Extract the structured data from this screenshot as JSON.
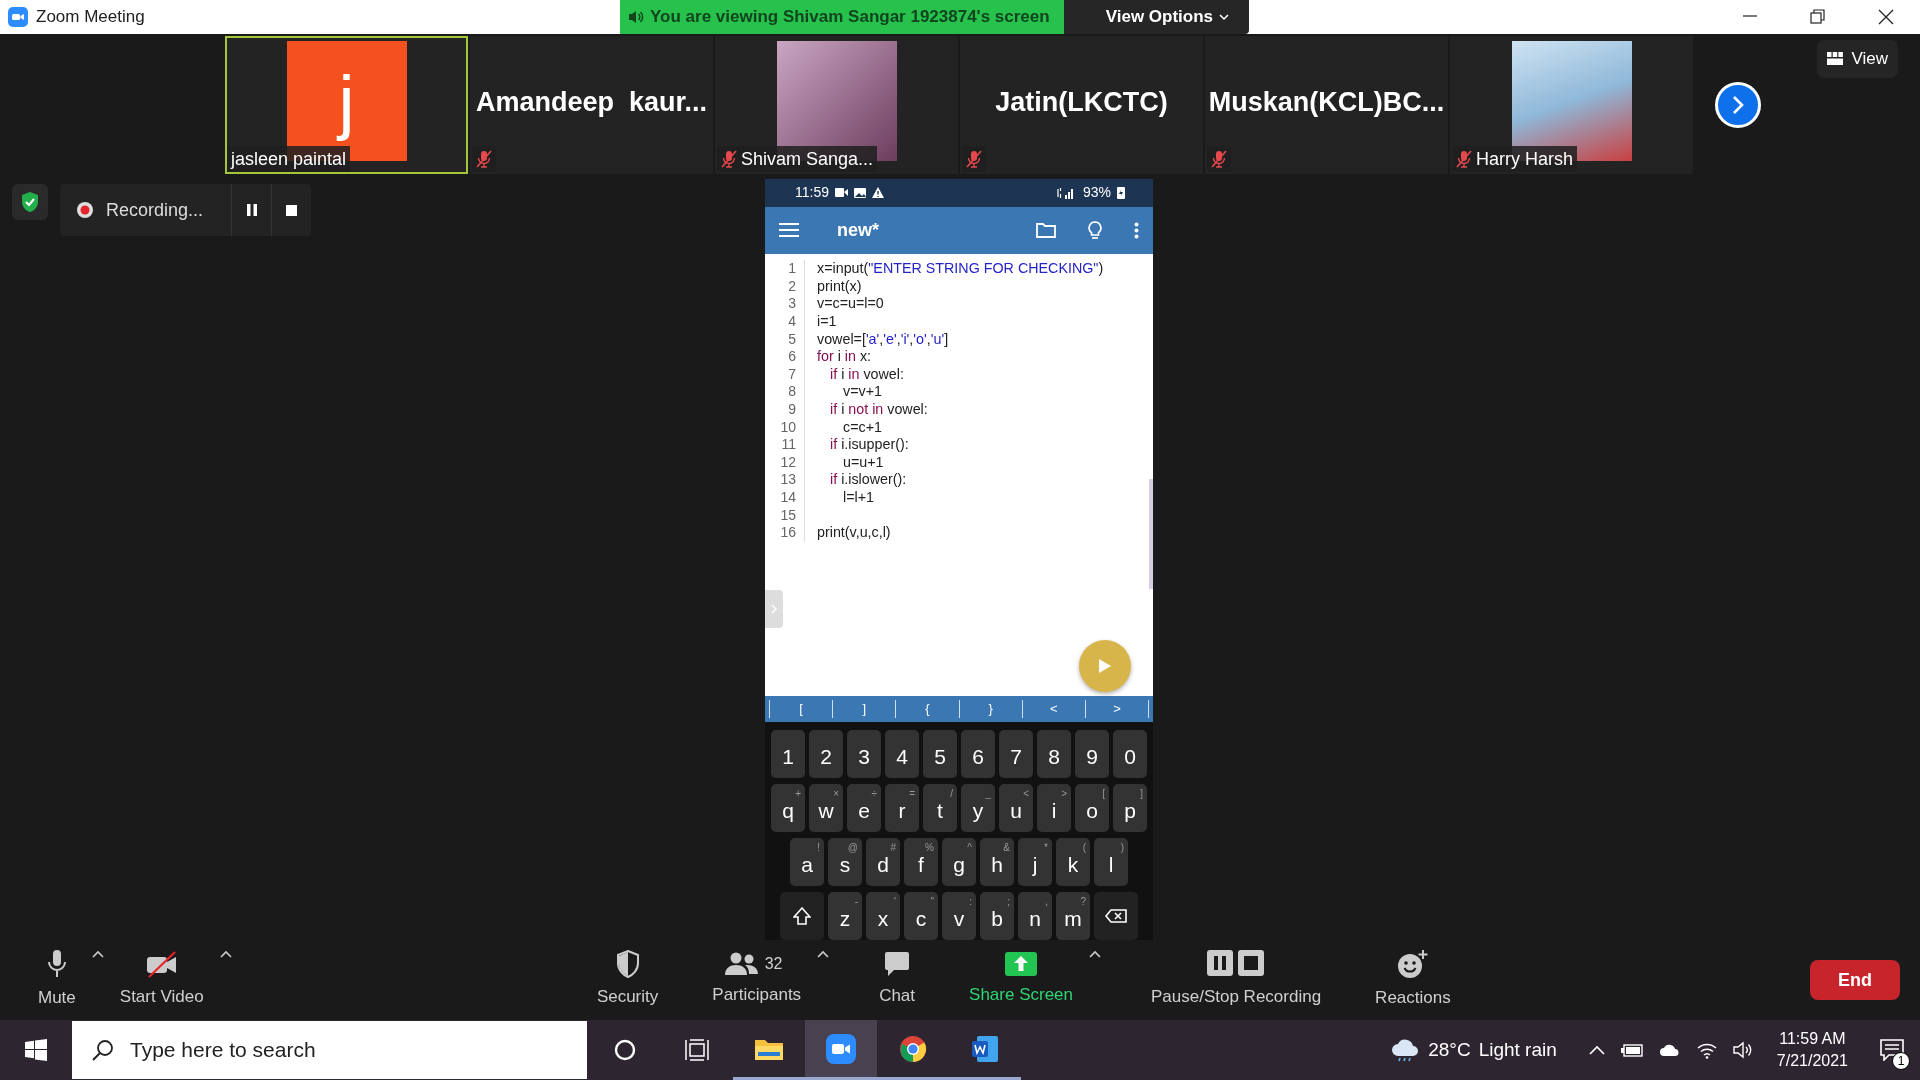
{
  "window": {
    "title": "Zoom Meeting"
  },
  "share_banner": {
    "text": "You are viewing Shivam Sangar 1923874's screen",
    "options": "View Options"
  },
  "participants": [
    {
      "kind": "avatar",
      "letter": "j",
      "color": "#f4511e",
      "label": "jasleen paintal",
      "muted": false,
      "speaking": true
    },
    {
      "kind": "name",
      "name": "Amandeep  kaur...",
      "muted": true,
      "speaking": false
    },
    {
      "kind": "photo",
      "label": "Shivam Sanga...",
      "muted": true,
      "speaking": false
    },
    {
      "kind": "name",
      "name": "Jatin(LKCTC)",
      "muted": true,
      "speaking": false
    },
    {
      "kind": "name",
      "name": "Muskan(KCL)BC...",
      "muted": true,
      "speaking": false
    },
    {
      "kind": "photo",
      "label": "Harry Harsh",
      "muted": true,
      "speaking": false
    }
  ],
  "view_button": "View",
  "recording": {
    "label": "Recording..."
  },
  "phone": {
    "status": {
      "time": "11:59",
      "battery": "93%"
    },
    "app": {
      "title": "new*"
    },
    "code": [
      {
        "number": "1",
        "tokens": [
          {
            "kind": "plain",
            "text": "x=input("
          },
          {
            "kind": "string",
            "text": "\"ENTER STRING FOR CHECKING\""
          },
          {
            "kind": "plain",
            "text": ")"
          }
        ]
      },
      {
        "number": "2",
        "tokens": [
          {
            "kind": "plain",
            "text": "print(x)"
          }
        ]
      },
      {
        "number": "3",
        "tokens": [
          {
            "kind": "plain",
            "text": "v=c=u=l=0"
          }
        ]
      },
      {
        "number": "4",
        "tokens": [
          {
            "kind": "plain",
            "text": "i=1"
          }
        ]
      },
      {
        "number": "5",
        "tokens": [
          {
            "kind": "plain",
            "text": "vowel=["
          },
          {
            "kind": "string",
            "text": "'a'"
          },
          {
            "kind": "plain",
            "text": ","
          },
          {
            "kind": "string",
            "text": "'e'"
          },
          {
            "kind": "plain",
            "text": ","
          },
          {
            "kind": "string",
            "text": "'i'"
          },
          {
            "kind": "plain",
            "text": ","
          },
          {
            "kind": "string",
            "text": "'o'"
          },
          {
            "kind": "plain",
            "text": ","
          },
          {
            "kind": "string",
            "text": "'u'"
          },
          {
            "kind": "plain",
            "text": "]"
          }
        ]
      },
      {
        "number": "6",
        "tokens": [
          {
            "kind": "keyword",
            "text": "for"
          },
          {
            "kind": "plain",
            "text": " i "
          },
          {
            "kind": "keyword",
            "text": "in"
          },
          {
            "kind": "plain",
            "text": " x:"
          }
        ],
        "children": [
          {
            "number": "7",
            "tokens": [
              {
                "kind": "keyword",
                "text": "if"
              },
              {
                "kind": "plain",
                "text": " i "
              },
              {
                "kind": "keyword",
                "text": "in"
              },
              {
                "kind": "plain",
                "text": " vowel:"
              }
            ],
            "children": [
              {
                "number": "8",
                "tokens": [
                  {
                    "kind": "plain",
                    "text": "v=v+1"
                  }
                ]
              }
            ]
          },
          {
            "number": "9",
            "tokens": [
              {
                "kind": "keyword",
                "text": "if"
              },
              {
                "kind": "plain",
                "text": " i "
              },
              {
                "kind": "keyword",
                "text": "not in"
              },
              {
                "kind": "plain",
                "text": " vowel:"
              }
            ],
            "children": [
              {
                "number": "10",
                "tokens": [
                  {
                    "kind": "plain",
                    "text": "c=c+1"
                  }
                ]
              }
            ]
          },
          {
            "number": "11",
            "tokens": [
              {
                "kind": "keyword",
                "text": "if"
              },
              {
                "kind": "plain",
                "text": " i.isupper():"
              }
            ],
            "children": [
              {
                "number": "12",
                "tokens": [
                  {
                    "kind": "plain",
                    "text": "u=u+1"
                  }
                ]
              }
            ]
          },
          {
            "number": "13",
            "tokens": [
              {
                "kind": "keyword",
                "text": "if"
              },
              {
                "kind": "plain",
                "text": " i.islower():"
              }
            ],
            "children": [
              {
                "number": "14",
                "tokens": [
                  {
                    "kind": "plain",
                    "text": "l=l+1"
                  }
                ]
              }
            ]
          }
        ]
      },
      {
        "number": "15"
      },
      {
        "number": "16",
        "tokens": [
          {
            "kind": "plain",
            "text": "print(v,u,c,l)"
          }
        ]
      }
    ],
    "symbols": [
      "[",
      "]",
      "{",
      "}",
      "<",
      ">"
    ],
    "keyboard": [
      [
        {
          "kind": "key",
          "label": "1"
        },
        {
          "kind": "key",
          "label": "2"
        },
        {
          "kind": "key",
          "label": "3"
        },
        {
          "kind": "key",
          "label": "4"
        },
        {
          "kind": "key",
          "label": "5"
        },
        {
          "kind": "key",
          "label": "6"
        },
        {
          "kind": "key",
          "label": "7"
        },
        {
          "kind": "key",
          "label": "8"
        },
        {
          "kind": "key",
          "label": "9"
        },
        {
          "kind": "key",
          "label": "0"
        }
      ],
      [
        {
          "kind": "key",
          "label": "q",
          "hint": "+"
        },
        {
          "kind": "key",
          "label": "w",
          "hint": "×"
        },
        {
          "kind": "key",
          "label": "e",
          "hint": "÷"
        },
        {
          "kind": "key",
          "label": "r",
          "hint": "="
        },
        {
          "kind": "key",
          "label": "t",
          "hint": "/"
        },
        {
          "kind": "key",
          "label": "y",
          "hint": "_"
        },
        {
          "kind": "key",
          "label": "u",
          "hint": "<"
        },
        {
          "kind": "key",
          "label": "i",
          "hint": ">"
        },
        {
          "kind": "key",
          "label": "o",
          "hint": "["
        },
        {
          "kind": "key",
          "label": "p",
          "hint": "]"
        }
      ],
      [
        {
          "kind": "key",
          "label": "a",
          "hint": "!"
        },
        {
          "kind": "key",
          "label": "s",
          "hint": "@"
        },
        {
          "kind": "key",
          "label": "d",
          "hint": "#"
        },
        {
          "kind": "key",
          "label": "f",
          "hint": "%"
        },
        {
          "kind": "key",
          "label": "g",
          "hint": "^"
        },
        {
          "kind": "key",
          "label": "h",
          "hint": "&"
        },
        {
          "kind": "key",
          "label": "j",
          "hint": "*"
        },
        {
          "kind": "key",
          "label": "k",
          "hint": "("
        },
        {
          "kind": "key",
          "label": "l",
          "hint": ")"
        }
      ],
      [
        {
          "kind": "shift"
        },
        {
          "kind": "key",
          "label": "z",
          "hint": "-"
        },
        {
          "kind": "key",
          "label": "x",
          "hint": "'"
        },
        {
          "kind": "key",
          "label": "c",
          "hint": "\""
        },
        {
          "kind": "key",
          "label": "v",
          "hint": ":"
        },
        {
          "kind": "key",
          "label": "b",
          "hint": ";"
        },
        {
          "kind": "key",
          "label": "n",
          "hint": ","
        },
        {
          "kind": "key",
          "label": "m",
          "hint": "?"
        },
        {
          "kind": "backspace"
        }
      ]
    ]
  },
  "toolbar": {
    "items": [
      {
        "label": "Mute",
        "caret": true,
        "highlight": false
      },
      {
        "label": "Start Video",
        "caret": true,
        "highlight": false
      },
      {
        "label": "Security",
        "caret": false,
        "highlight": false
      },
      {
        "label": "Participants",
        "count": "32",
        "caret": true,
        "highlight": false
      },
      {
        "label": "Chat",
        "caret": false,
        "highlight": false
      },
      {
        "label": "Share Screen",
        "caret": true,
        "highlight": true
      },
      {
        "label": "Pause/Stop Recording",
        "caret": false,
        "highlight": false
      },
      {
        "label": "Reactions",
        "caret": false,
        "highlight": false
      }
    ],
    "end": "End"
  },
  "taskbar": {
    "search_placeholder": "Type here to search",
    "apps": [
      {
        "running": false,
        "active": false
      },
      {
        "running": false,
        "active": false
      },
      {
        "running": true,
        "active": false
      },
      {
        "running": true,
        "active": true
      },
      {
        "running": true,
        "active": false
      },
      {
        "running": true,
        "active": false
      }
    ],
    "weather": {
      "temp": "28°C",
      "text": "Light rain"
    },
    "time": "11:59 AM",
    "date": "7/21/2021",
    "notifications": "1"
  }
}
